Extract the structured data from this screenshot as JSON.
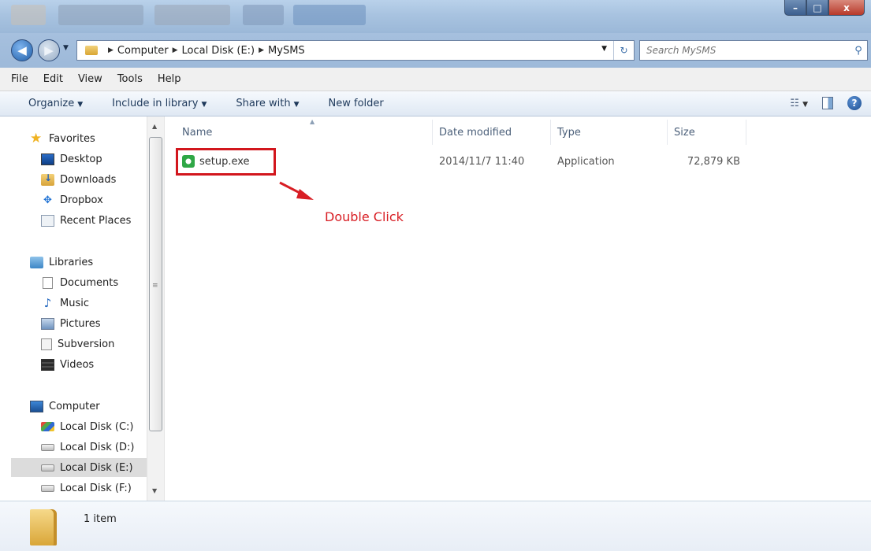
{
  "window": {
    "controls": [
      "–",
      "□",
      "x"
    ]
  },
  "address": {
    "crumbs": [
      "Computer",
      "Local Disk (E:)",
      "MySMS"
    ]
  },
  "search": {
    "placeholder": "Search MySMS"
  },
  "menu": [
    "File",
    "Edit",
    "View",
    "Tools",
    "Help"
  ],
  "commands": {
    "organize": "Organize",
    "include_library": "Include in library",
    "share_with": "Share with",
    "new_folder": "New folder"
  },
  "nav": {
    "favorites": {
      "label": "Favorites",
      "items": [
        "Desktop",
        "Downloads",
        "Dropbox",
        "Recent Places"
      ]
    },
    "libraries": {
      "label": "Libraries",
      "items": [
        "Documents",
        "Music",
        "Pictures",
        "Subversion",
        "Videos"
      ]
    },
    "computer": {
      "label": "Computer",
      "items": [
        "Local Disk (C:)",
        "Local Disk (D:)",
        "Local Disk (E:)",
        "Local Disk (F:)"
      ],
      "selected": "Local Disk (E:)"
    }
  },
  "columns": [
    "Name",
    "Date modified",
    "Type",
    "Size"
  ],
  "files": [
    {
      "name": "setup.exe",
      "modified": "2014/11/7 11:40",
      "type": "Application",
      "size": "72,879 KB"
    }
  ],
  "annotation": {
    "text": "Double Click",
    "color": "#d81e24"
  },
  "status": {
    "count": "1 item"
  },
  "icons": [
    "back-icon",
    "forward-icon",
    "folder-icon",
    "refresh-icon",
    "search-icon",
    "views-icon",
    "preview-pane-icon",
    "help-icon",
    "star-icon",
    "application-icon"
  ]
}
